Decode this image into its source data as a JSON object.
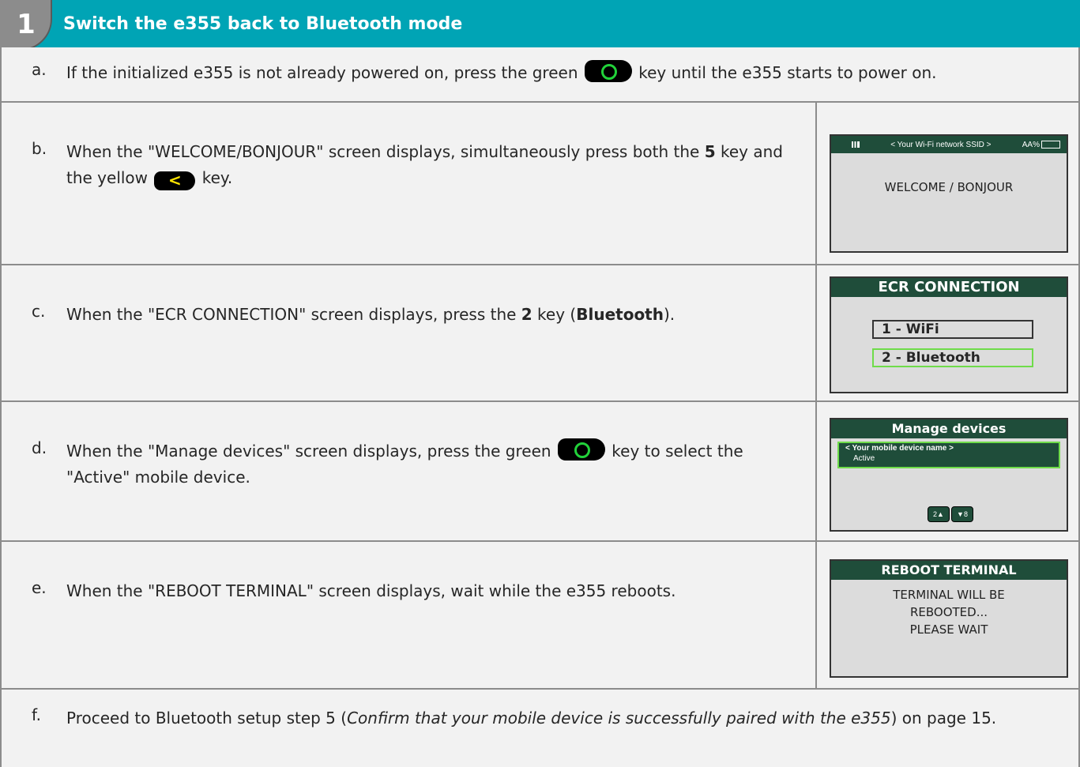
{
  "header": {
    "step_number": "1",
    "title": "Switch the e355 back to Bluetooth mode"
  },
  "steps": {
    "a": {
      "letter": "a.",
      "t1": "If the initialized e355 is not already powered on, press the green ",
      "t2": " key until the e355 starts to power on."
    },
    "b": {
      "letter": "b.",
      "t1": "When the \"WELCOME/BONJOUR\" screen displays, simultaneously press both the ",
      "key": "5",
      "t2": " key and the yellow ",
      "yellow_key": "<",
      "t3": " key."
    },
    "c": {
      "letter": "c.",
      "t1": "When the \"ECR CONNECTION\" screen displays, press the ",
      "key": "2",
      "t2": " key (",
      "bt": "Bluetooth",
      "t3": ")."
    },
    "d": {
      "letter": "d.",
      "t1": "When the \"Manage devices\" screen displays, press the green ",
      "t2": " key to select the \"Active\" mobile device."
    },
    "e": {
      "letter": "e.",
      "t1": "When the \"REBOOT TERMINAL\" screen displays, wait while the e355 reboots."
    },
    "f": {
      "letter": "f.",
      "t1": "Proceed to Bluetooth setup step 5 (",
      "italic": "Confirm that your mobile device is successfully paired with the e355",
      "t2": ") on page 15."
    }
  },
  "screens": {
    "welcome": {
      "ssid": "< Your Wi-Fi network SSID >",
      "battery": "AA%",
      "message": "WELCOME / BONJOUR"
    },
    "ecr": {
      "title": "ECR CONNECTION",
      "opt1": "1 - WiFi",
      "opt2": "2 - Bluetooth"
    },
    "manage": {
      "title": "Manage devices",
      "device_name": "< Your mobile device name >",
      "device_status": "Active",
      "nav_left": "2▲",
      "nav_right": "▼8"
    },
    "reboot": {
      "title": "REBOOT TERMINAL",
      "line1": "TERMINAL WILL BE",
      "line2": "REBOOTED...",
      "line3": "PLEASE WAIT"
    }
  },
  "colors": {
    "header": "#00a4b5",
    "green_key_ring": "#22d23a",
    "yellow_key_glyph": "#ffe400",
    "screen_header": "#1f4d3a",
    "selection": "#6fdc4a"
  }
}
